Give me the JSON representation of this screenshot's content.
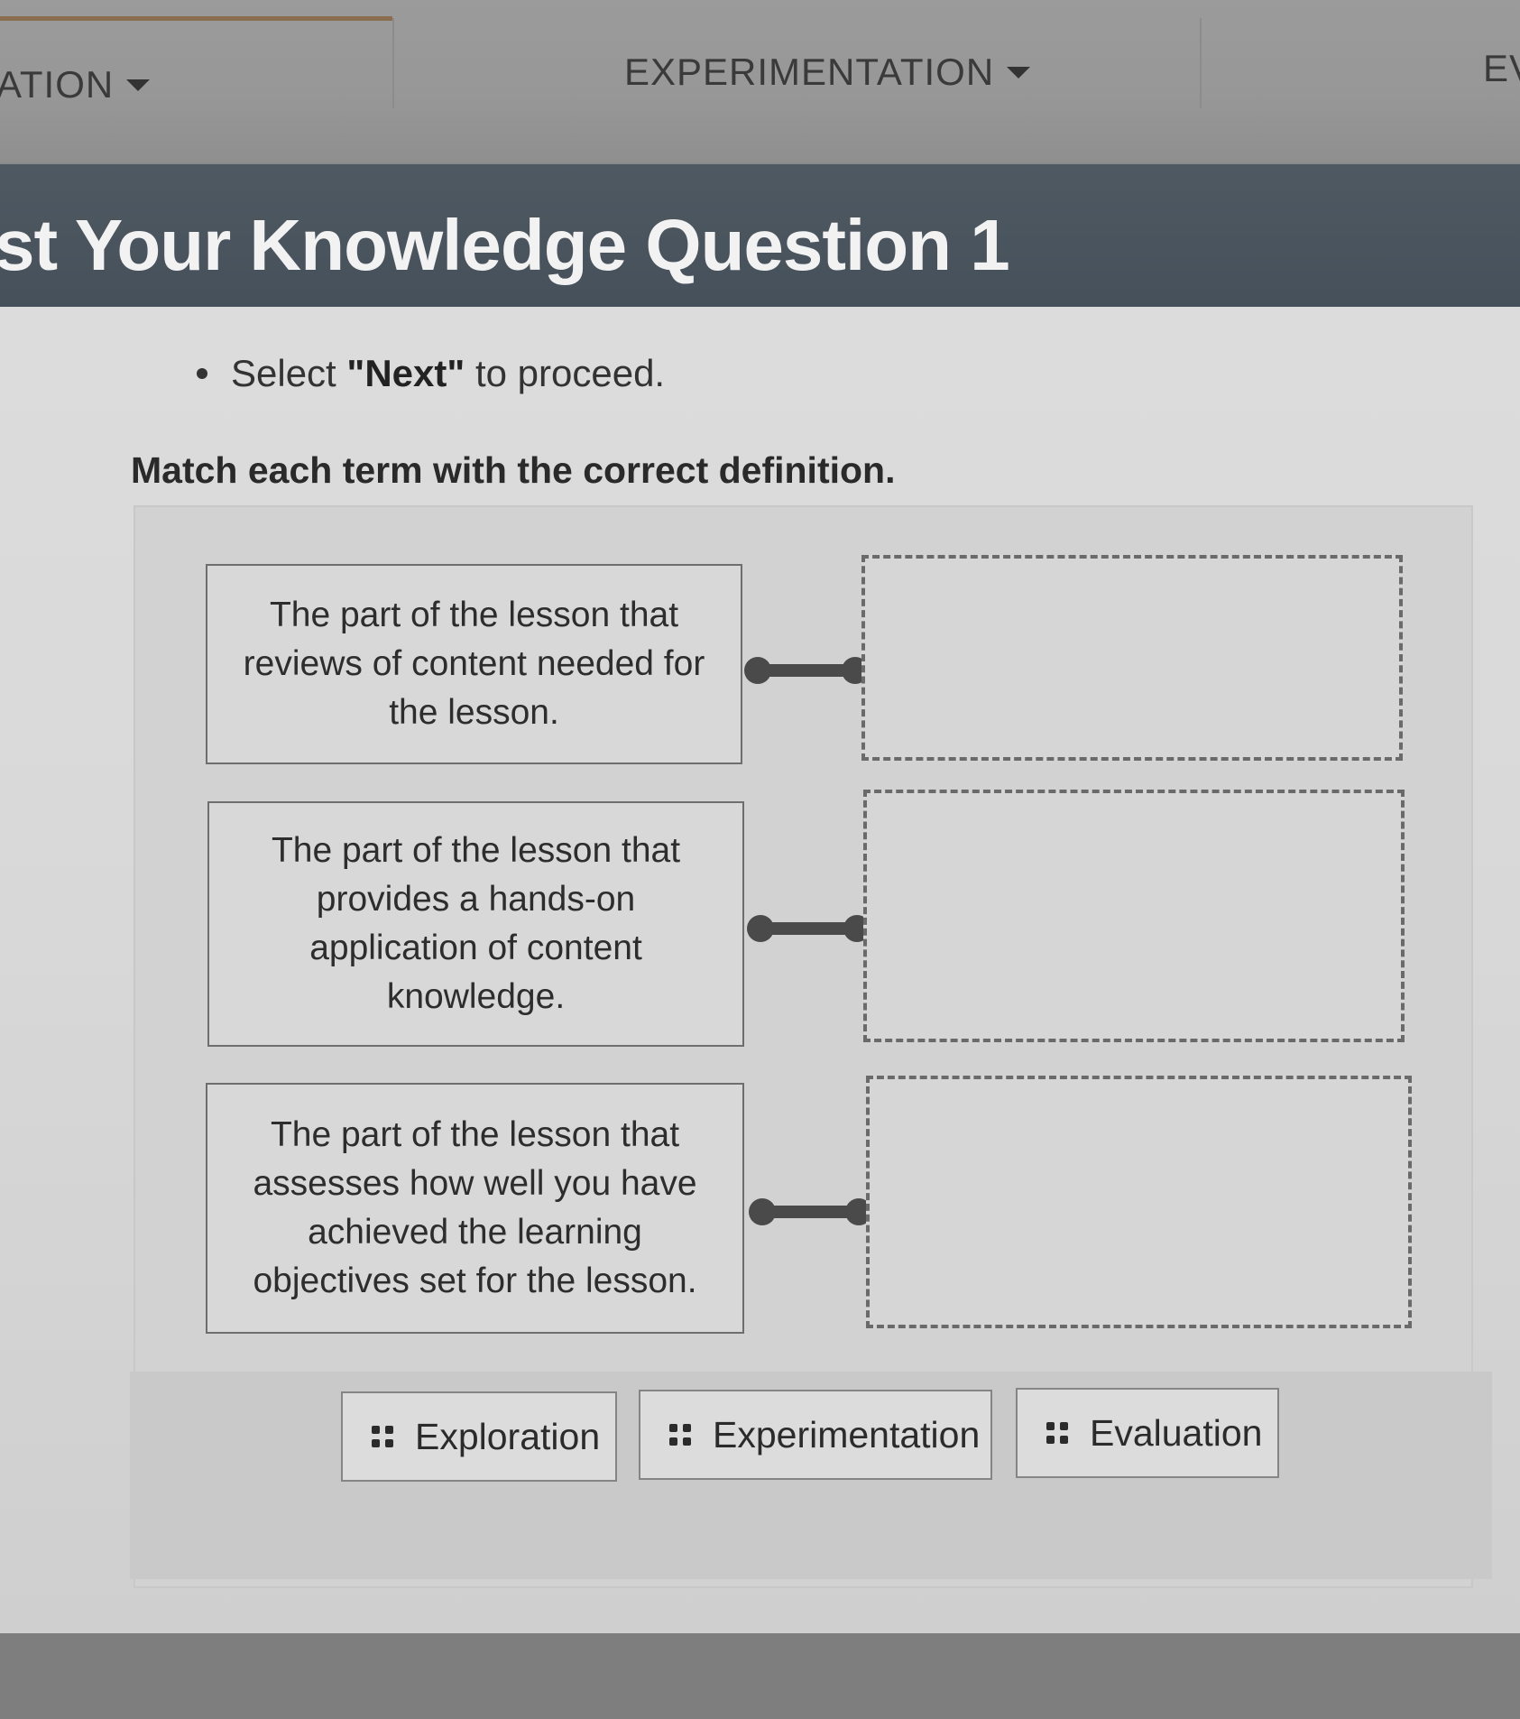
{
  "nav": {
    "items": [
      {
        "label": "ATION"
      },
      {
        "label": "EXPERIMENTATION"
      },
      {
        "label": "EV"
      }
    ]
  },
  "banner": {
    "title": "st Your Knowledge Question 1"
  },
  "instruction": {
    "pre": "Select ",
    "bold": "\"Next\"",
    "post": " to proceed."
  },
  "prompt": "Match each term with the correct definition.",
  "definitions": [
    {
      "text": "The part of the lesson that reviews of content needed for the lesson."
    },
    {
      "text": "The part of the lesson that provides a hands-on application of content knowledge."
    },
    {
      "text": "The part of the lesson that assesses how well you have achieved the learning objectives set for the lesson."
    }
  ],
  "terms": [
    {
      "label": "Exploration"
    },
    {
      "label": "Experimentation"
    },
    {
      "label": "Evaluation"
    }
  ],
  "icons": {
    "dropdown": "caret-down-icon",
    "drag": "drag-handle-icon"
  }
}
